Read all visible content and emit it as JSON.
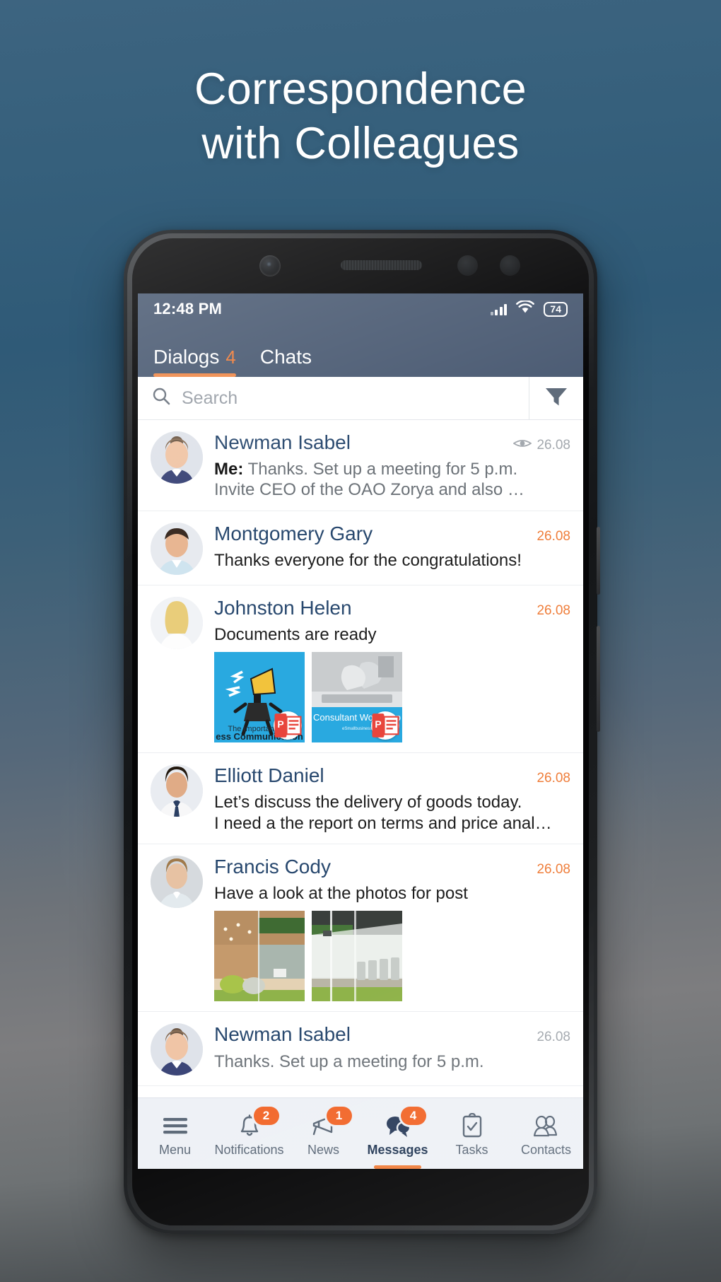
{
  "headline": {
    "line1": "Correspondence",
    "line2": "with Colleagues"
  },
  "phone": {
    "status_bar": {
      "time": "12:48 PM",
      "battery": "74",
      "signal_icon": "signal-bars-icon",
      "wifi_icon": "wifi-icon"
    },
    "tabs": [
      {
        "label": "Dialogs",
        "count": "4",
        "active": true
      },
      {
        "label": "Chats",
        "count": "",
        "active": false
      }
    ],
    "search": {
      "placeholder": "Search",
      "value": "",
      "icon": "search-icon",
      "filter_icon": "filter-icon"
    },
    "conversations": [
      {
        "name": "Newman Isabel",
        "date": "26.08",
        "date_color": "grey",
        "seen_icon": "eye-icon",
        "has_seen_icon": true,
        "prefix": "Me:",
        "message": "Thanks. Set up a meeting for 5 p.m.\nInvite CEO of the OAO Zorya and also …",
        "read": true,
        "attachments": []
      },
      {
        "name": "Montgomery Gary",
        "date": "26.08",
        "date_color": "orange",
        "has_seen_icon": false,
        "prefix": "",
        "message": "Thanks everyone for the congratulations!",
        "read": false,
        "attachments": []
      },
      {
        "name": "Johnston Helen",
        "date": "26.08",
        "date_color": "orange",
        "has_seen_icon": false,
        "prefix": "",
        "message": "Documents are ready",
        "read": false,
        "attachments": [
          {
            "kind": "presentation",
            "caption": "The Importance of Business Communication",
            "badge": "ppt-file-icon"
          },
          {
            "kind": "presentation",
            "caption": "Consultant Workshop",
            "badge": "ppt-file-icon"
          }
        ]
      },
      {
        "name": "Elliott Daniel",
        "date": "26.08",
        "date_color": "orange",
        "has_seen_icon": false,
        "prefix": "",
        "message": "Let’s discuss the delivery of goods today.\nI need a the report on terms and price anal…",
        "read": false,
        "attachments": []
      },
      {
        "name": "Francis Cody",
        "date": "26.08",
        "date_color": "orange",
        "has_seen_icon": false,
        "prefix": "",
        "message": "Have a look at the photos for post",
        "read": false,
        "attachments": [
          {
            "kind": "photo",
            "caption": "",
            "badge": ""
          },
          {
            "kind": "photo",
            "caption": "",
            "badge": ""
          }
        ]
      },
      {
        "name": "Newman Isabel",
        "date": "26.08",
        "date_color": "grey",
        "has_seen_icon": false,
        "prefix": "",
        "message": "Thanks. Set up a meeting for 5 p.m.",
        "read": true,
        "attachments": []
      }
    ],
    "bottom_nav": [
      {
        "label": "Menu",
        "icon": "hamburger-menu-icon",
        "badge": "",
        "active": false
      },
      {
        "label": "Notifications",
        "icon": "bell-icon",
        "badge": "2",
        "active": false
      },
      {
        "label": "News",
        "icon": "megaphone-icon",
        "badge": "1",
        "active": false
      },
      {
        "label": "Messages",
        "icon": "chat-bubbles-icon",
        "badge": "4",
        "active": true
      },
      {
        "label": "Tasks",
        "icon": "clipboard-check-icon",
        "badge": "",
        "active": false
      },
      {
        "label": "Contacts",
        "icon": "people-icon",
        "badge": "",
        "active": false
      }
    ]
  },
  "colors": {
    "accent_orange": "#f07f3c",
    "badge_orange": "#f2672a",
    "header_blue": "#4b5b73",
    "name_blue": "#28486e",
    "background_top": "#36607c"
  }
}
